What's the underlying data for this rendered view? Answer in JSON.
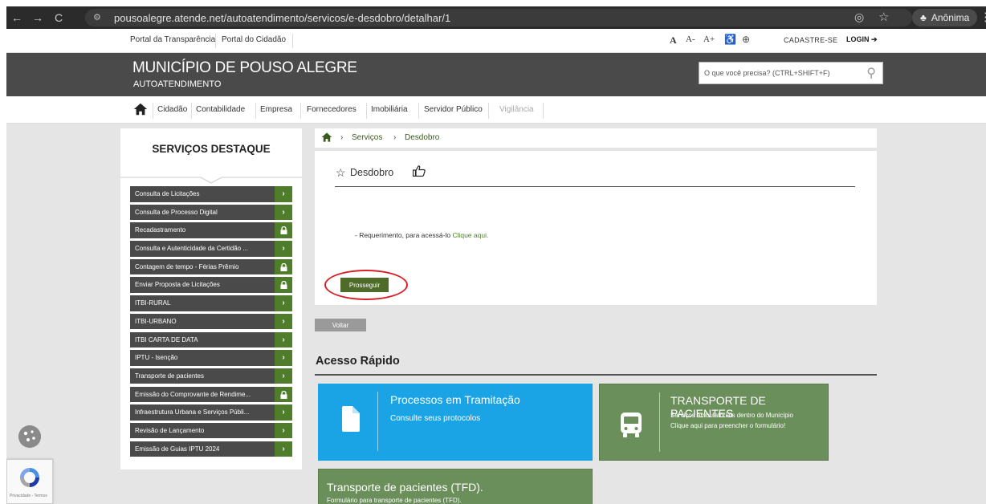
{
  "browser": {
    "url": "pousoalegre.atende.net/autoatendimento/servicos/e-desdobro/detalhar/1",
    "incognito_label": "Anônima"
  },
  "topbar": {
    "links": [
      "Portal da Transparência",
      "Portal do Cidadão"
    ],
    "font_controls": [
      "A",
      "A-",
      "A+"
    ],
    "register": "CADASTRE-SE",
    "login": "LOGIN"
  },
  "banner": {
    "title": "MUNICÍPIO DE POUSO ALEGRE",
    "subtitle": "AUTOATENDIMENTO",
    "search_placeholder": "O que você precisa? (CTRL+SHIFT+F)"
  },
  "menu": {
    "items": [
      "Cidadão",
      "Contabilidade",
      "Empresa",
      "Fornecedores",
      "Imobiliária",
      "Servidor Público",
      "Vigilância"
    ]
  },
  "sidebar": {
    "title": "SERVIÇOS DESTAQUE",
    "items": [
      {
        "label": "Consulta de Licitações",
        "icon": "chevron-right"
      },
      {
        "label": "Consulta de Processo Digital",
        "icon": "chevron-right"
      },
      {
        "label": "Recadastramento",
        "icon": "lock"
      },
      {
        "label": "Consulta e Autenticidade da Certidão ...",
        "icon": "chevron-right"
      },
      {
        "label": "Contagem de tempo - Férias Prêmio",
        "icon": "lock"
      },
      {
        "label": "Enviar Proposta de Licitações",
        "icon": "lock"
      },
      {
        "label": "ITBI-RURAL",
        "icon": "chevron-right"
      },
      {
        "label": "ITBI-URBANO",
        "icon": "chevron-right"
      },
      {
        "label": "ITBI CARTA DE DATA",
        "icon": "chevron-right"
      },
      {
        "label": "IPTU - Isenção",
        "icon": "chevron-right"
      },
      {
        "label": "Transporte de pacientes",
        "icon": "chevron-right"
      },
      {
        "label": "Emissão do Comprovante de Rendime...",
        "icon": "lock"
      },
      {
        "label": "Infraestrutura Urbana e Serviços Públi...",
        "icon": "chevron-right"
      },
      {
        "label": "Revisão de Lançamento",
        "icon": "chevron-right"
      },
      {
        "label": "Emissão de Guias IPTU 2024",
        "icon": "chevron-right"
      }
    ]
  },
  "breadcrumb": {
    "items": [
      "Serviços",
      "Desdobro"
    ]
  },
  "service": {
    "title": "Desdobro",
    "request_text": "- Requerimento, para acessá-lo",
    "request_link": "Clique aqui.",
    "proceed_button": "Prosseguir",
    "back_button": "Voltar"
  },
  "quick_access": {
    "title": "Acesso Rápido",
    "tiles": [
      {
        "title": "Processos em Tramitação",
        "subtitle": "Consulte seus protocolos"
      },
      {
        "title": "TRANSPORTE DE PACIENTES",
        "line1": "Serviços ambulatoriais dentro do Município",
        "line2": "Clique aqui para preencher o formulário!"
      },
      {
        "title": "Transporte de pacientes (TFD).",
        "subtitle": "Formulário para transporte de pacientes (TFD)."
      }
    ]
  },
  "recaptcha": {
    "label": "Privacidade - Termos"
  },
  "colors": {
    "banner": "#4a4a4a",
    "accent_green": "#4f7d2c",
    "tile_blue": "#1aa4e6",
    "tile_green": "#6a8f5a"
  }
}
